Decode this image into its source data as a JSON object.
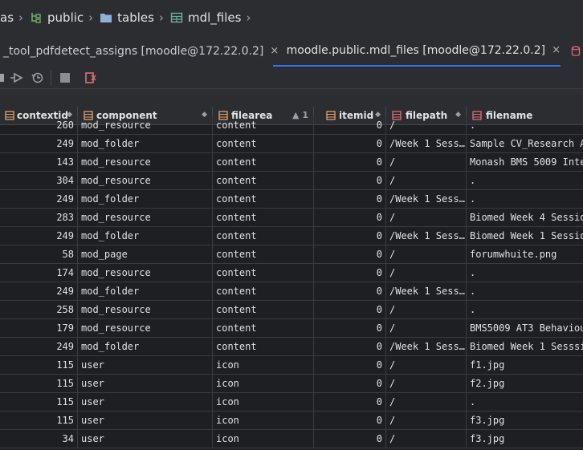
{
  "breadcrumb": {
    "items": [
      {
        "label": "as",
        "icon": "none"
      },
      {
        "label": "public",
        "icon": "schema-icon"
      },
      {
        "label": "tables",
        "icon": "folder-icon"
      },
      {
        "label": "mdl_files",
        "icon": "table-icon"
      }
    ]
  },
  "tabs": [
    {
      "label": "_tool_pdfdetect_assigns [moodle@172.22.0.2]",
      "active": false
    },
    {
      "label": "moodle.public.mdl_files [moodle@172.22.0.2]",
      "active": true
    }
  ],
  "close_glyph": "×",
  "columns": [
    {
      "label": "contextid",
      "sort": "◆"
    },
    {
      "label": "component",
      "sort": "◆"
    },
    {
      "label": "filearea",
      "sort": "▲ 1"
    },
    {
      "label": "itemid",
      "sort": "◆"
    },
    {
      "label": "filepath",
      "sort": "◆"
    },
    {
      "label": "filename",
      "sort": ""
    }
  ],
  "rows": [
    [
      "260",
      "mod_resource",
      "content",
      "0",
      "/",
      "."
    ],
    [
      "249",
      "mod_folder",
      "content",
      "0",
      "/Week 1 Sess…",
      "Sample CV_Research A"
    ],
    [
      "143",
      "mod_resource",
      "content",
      "0",
      "/",
      "Monash BMS 5009 Inte"
    ],
    [
      "304",
      "mod_resource",
      "content",
      "0",
      "/",
      "."
    ],
    [
      "249",
      "mod_folder",
      "content",
      "0",
      "/Week 1 Sess…",
      "."
    ],
    [
      "283",
      "mod_resource",
      "content",
      "0",
      "/",
      "Biomed Week 4 Sessio"
    ],
    [
      "249",
      "mod_folder",
      "content",
      "0",
      "/Week 1 Sess…",
      "Biomed Week 1 Sessio"
    ],
    [
      "58",
      "mod_page",
      "content",
      "0",
      "/",
      "forumwhuite.png"
    ],
    [
      "174",
      "mod_resource",
      "content",
      "0",
      "/",
      "."
    ],
    [
      "249",
      "mod_folder",
      "content",
      "0",
      "/Week 1 Sess…",
      "."
    ],
    [
      "258",
      "mod_resource",
      "content",
      "0",
      "/",
      "."
    ],
    [
      "179",
      "mod_resource",
      "content",
      "0",
      "/",
      "BMS5009 AT3 Behaviou"
    ],
    [
      "249",
      "mod_folder",
      "content",
      "0",
      "/Week 1 Sess…",
      "Biomed Week 1 Sesssi"
    ],
    [
      "115",
      "user",
      "icon",
      "0",
      "/",
      "f1.jpg"
    ],
    [
      "115",
      "user",
      "icon",
      "0",
      "/",
      "f2.jpg"
    ],
    [
      "115",
      "user",
      "icon",
      "0",
      "/",
      "."
    ],
    [
      "115",
      "user",
      "icon",
      "0",
      "/",
      "f3.jpg"
    ],
    [
      "34",
      "user",
      "icon",
      "0",
      "/",
      "f3.jpg"
    ]
  ],
  "colors": {
    "accent": "#3574f0",
    "background": "#1e1f22",
    "panel": "#2b2d30",
    "column_icon": "#e5a06b",
    "db_icon": "#e06c75"
  }
}
